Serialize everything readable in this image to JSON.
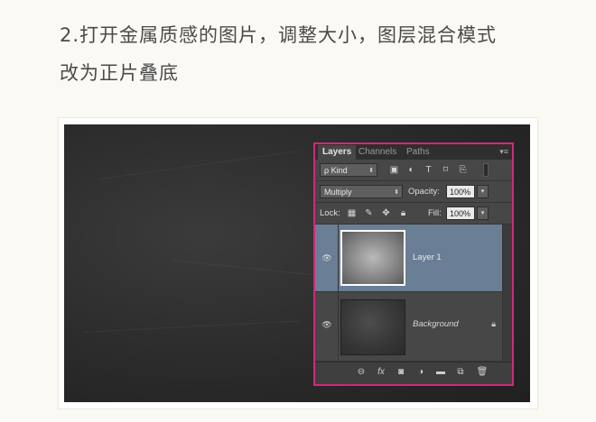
{
  "article": {
    "line1": "2.打开金属质感的图片，调整大小，图层混合模式",
    "line2": "改为正片叠底"
  },
  "layers_panel": {
    "tabs": [
      {
        "label": "Layers",
        "active": true
      },
      {
        "label": "Channels",
        "active": false
      },
      {
        "label": "Paths",
        "active": false
      }
    ],
    "filter": {
      "label": "ρ Kind"
    },
    "blend_mode": "Multiply",
    "opacity_label": "Opacity:",
    "opacity_value": "100%",
    "lock_label": "Lock:",
    "fill_label": "Fill:",
    "fill_value": "100%",
    "layers": [
      {
        "name": "Layer 1",
        "selected": true
      },
      {
        "name": "Background",
        "selected": false,
        "locked": true
      }
    ],
    "accent_color": "#d3287a",
    "selection_color": "#6a7e95"
  }
}
